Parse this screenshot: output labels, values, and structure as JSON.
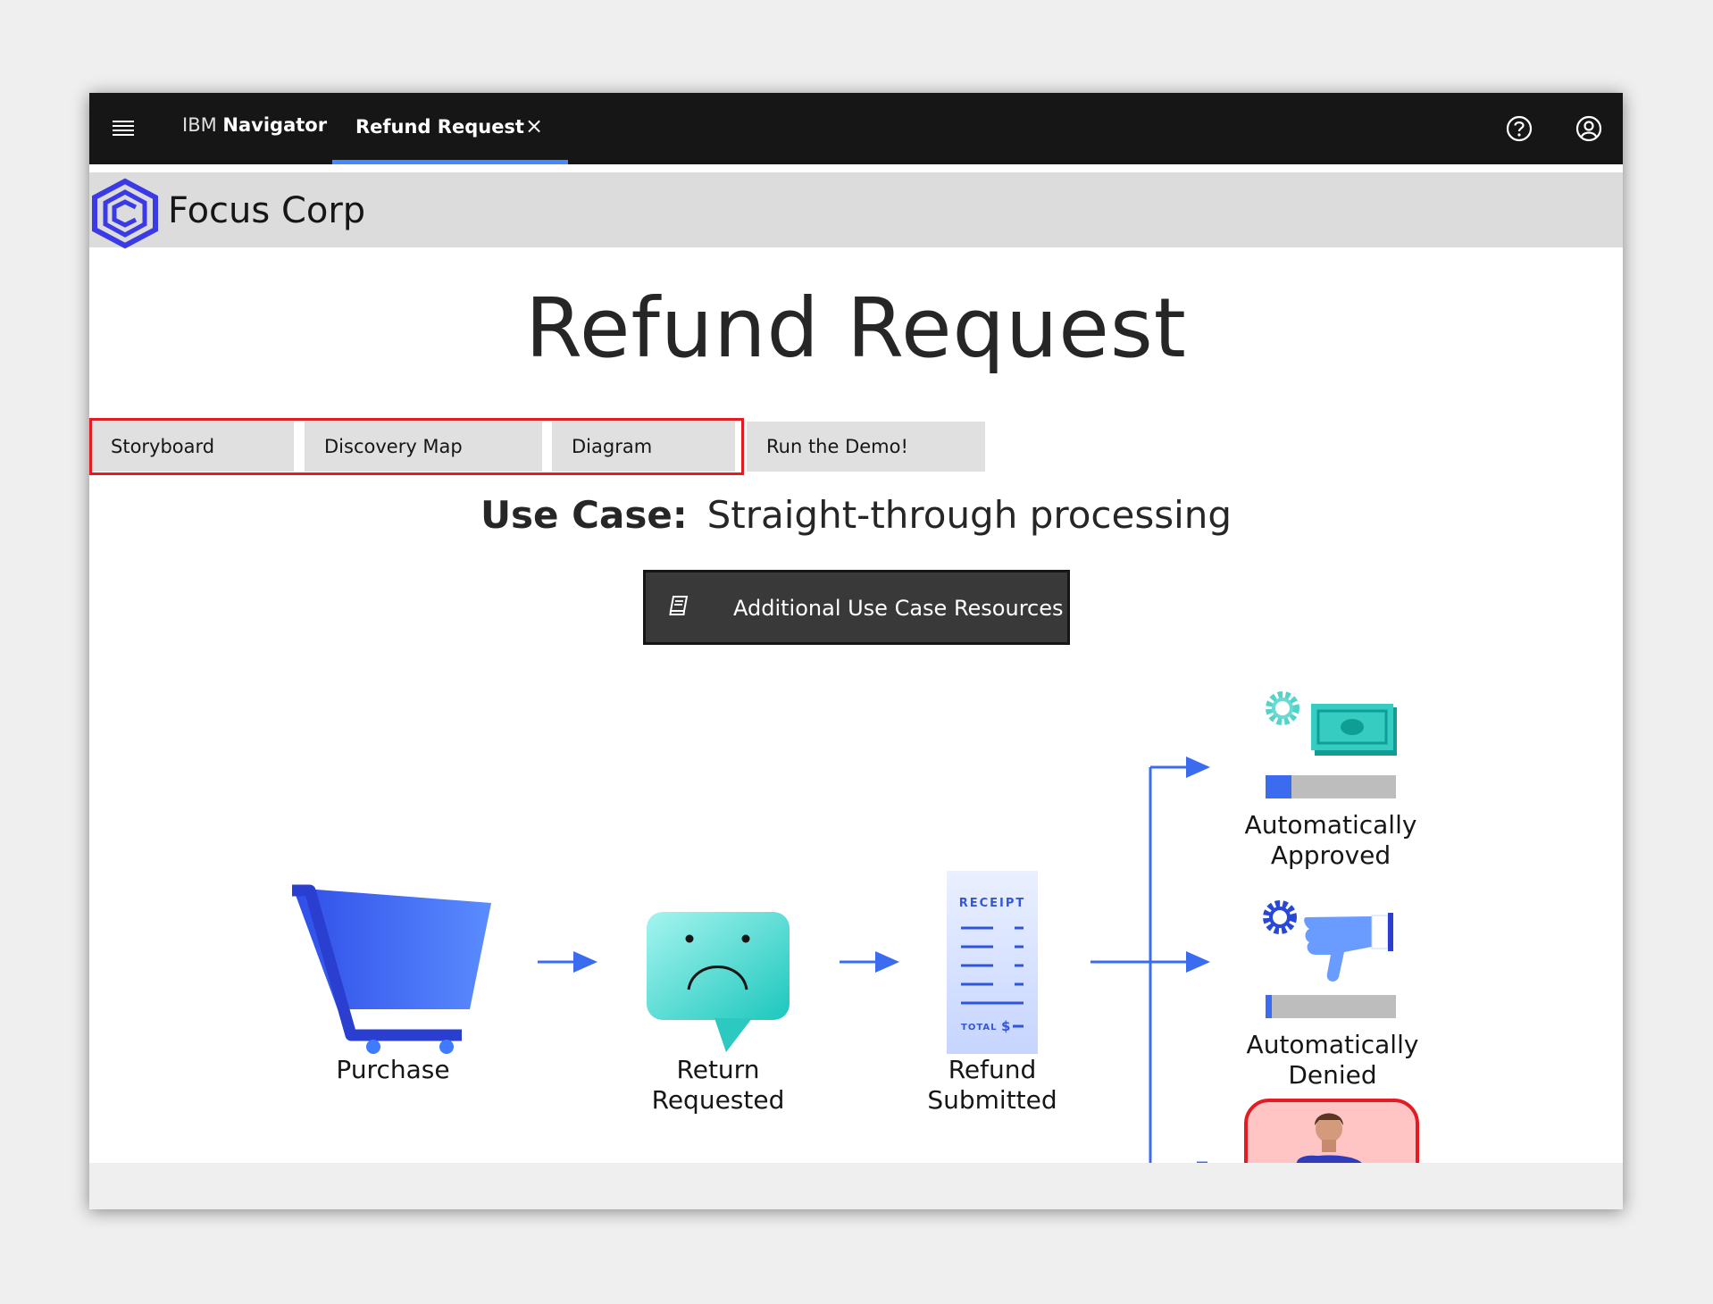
{
  "header": {
    "nav_prefix": "IBM",
    "nav_name": "Navigator",
    "active_tab": "Refund Request",
    "close_glyph": "×"
  },
  "brand": {
    "name": "Focus Corp"
  },
  "page": {
    "title": "Refund Request"
  },
  "tabs": [
    {
      "label": "Storyboard"
    },
    {
      "label": "Discovery Map"
    },
    {
      "label": "Diagram"
    },
    {
      "label": "Run the Demo!"
    }
  ],
  "use_case": {
    "label": "Use Case:",
    "value": "Straight-through processing"
  },
  "resources_button": {
    "label": "Additional Use Case Resources",
    "icon": "book-icon"
  },
  "flow": {
    "steps": [
      {
        "line1": "Purchase",
        "line2": "",
        "icon": "shopping-cart-icon"
      },
      {
        "line1": "Return",
        "line2": "Requested",
        "icon": "sad-face-chat-icon"
      },
      {
        "line1": "Refund",
        "line2": "Submitted",
        "icon": "receipt-icon"
      }
    ],
    "receipt_text": "RECEIPT",
    "receipt_total": "TOTAL",
    "receipt_currency": "$",
    "outcomes": [
      {
        "line1": "Automatically",
        "line2": "Approved",
        "icon": "money-gear-icon",
        "progress": 0.2
      },
      {
        "line1": "Automatically",
        "line2": "Denied",
        "icon": "thumbs-down-gear-icon",
        "progress": 0.05
      },
      {
        "icon": "person-avatar-icon"
      }
    ]
  },
  "colors": {
    "topbar": "#161616",
    "tab_underline": "#4589ff",
    "arrow_blue": "#3b6cf0",
    "highlight_red": "#e31c24",
    "teal": "#2ccdc2",
    "brand_blue": "#3a3ae6"
  }
}
